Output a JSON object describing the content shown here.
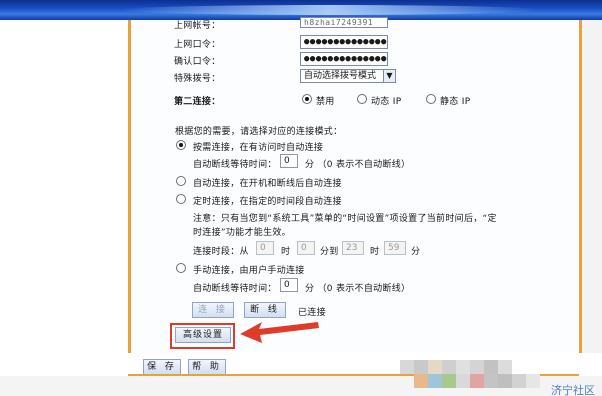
{
  "wan": {
    "account_label": "上网帐号：",
    "account_value": "h8zhai7249391",
    "password_label": "上网口令：",
    "password_value": "●●●●●●●●●●●●●●",
    "confirm_label": "确认口令：",
    "confirm_value": "●●●●●●●●●●●●●●",
    "special_dial_label": "特殊拨号：",
    "special_dial_value": "自动选择拨号模式"
  },
  "second_connection": {
    "label": "第二连接：",
    "options": [
      {
        "label": "禁用",
        "selected": true
      },
      {
        "label": "动态 IP",
        "selected": false
      },
      {
        "label": "静态 IP",
        "selected": false
      }
    ]
  },
  "mode": {
    "intro": "根据您的需要，请选择对应的连接模式：",
    "on_demand": {
      "label": "按需连接，在有访问时自动连接",
      "idle_label": "自动断线等待时间：",
      "idle_value": "0",
      "idle_unit": "分 （0 表示不自动断线）"
    },
    "auto": {
      "label": "自动连接，在开机和断线后自动连接"
    },
    "timed": {
      "label": "定时连接，在指定的时间段自动连接",
      "note_line1": "注意：只有当您到“系统工具”菜单的“时间设置”项设置了当前时间后，“定",
      "note_line2": "时连接”功能才能生效。",
      "period_label": "连接时段：从",
      "from_hour": "0",
      "hour_unit": "时",
      "from_min": "0",
      "to_label": "分到",
      "to_hour": "23",
      "to_min": "59",
      "min_unit": "分"
    },
    "manual": {
      "label": "手动连接，由用户手动连接",
      "idle_label": "自动断线等待时间：",
      "idle_value": "0",
      "idle_unit": "分 （0 表示不自动断线）"
    }
  },
  "actions": {
    "connect": "连 接",
    "disconnect": "断 线",
    "status": "已连接",
    "advanced": "高级设置",
    "save": "保 存",
    "help": "帮 助"
  },
  "watermark": "济宁社区",
  "colors": {
    "accent_border": "#e9a23a",
    "highlight": "#e03a2a",
    "banner": "#1a52c8"
  },
  "icons": {
    "dropdown": "chevron-down-icon",
    "annotation": "arrow-left-icon"
  }
}
